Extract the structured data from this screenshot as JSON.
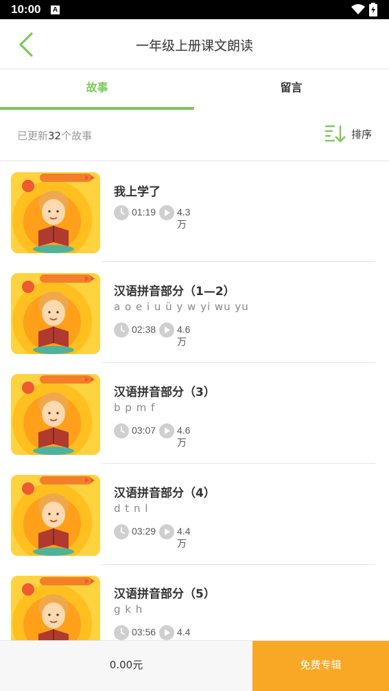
{
  "status_bar": {
    "time": "10:00",
    "notification_icon": "A"
  },
  "nav": {
    "title": "一年级上册课文朗读",
    "back_icon": "chevron-left-icon"
  },
  "tabs": [
    {
      "label": "故事",
      "active": true
    },
    {
      "label": "留言",
      "active": false
    }
  ],
  "info": {
    "prefix": "已更新",
    "count": "32",
    "suffix": "个故事",
    "sort_label": "排序"
  },
  "items": [
    {
      "title": "我上学了",
      "subtitle": "",
      "duration": "01:19",
      "plays": "4.3万",
      "badge": "一年级上册"
    },
    {
      "title": "汉语拼音部分（1—2）",
      "subtitle": "a o e i u ü y w yi wu yu",
      "duration": "02:38",
      "plays": "4.6万",
      "badge": "一年级上册"
    },
    {
      "title": "汉语拼音部分（3）",
      "subtitle": "b p m f",
      "duration": "03:07",
      "plays": "4.6万",
      "badge": "一年级上册"
    },
    {
      "title": "汉语拼音部分（4）",
      "subtitle": "d t n l",
      "duration": "03:29",
      "plays": "4.4万",
      "badge": "一年级上册"
    },
    {
      "title": "汉语拼音部分（5）",
      "subtitle": "g k h",
      "duration": "03:56",
      "plays": "4.4万",
      "badge": "一年级上册"
    }
  ],
  "bottom": {
    "price": "0.00元",
    "free_button": "免费专辑"
  },
  "colors": {
    "accent_green": "#7cc85a",
    "accent_orange": "#f9a825",
    "thumb_yellow": "#ffd23f"
  }
}
